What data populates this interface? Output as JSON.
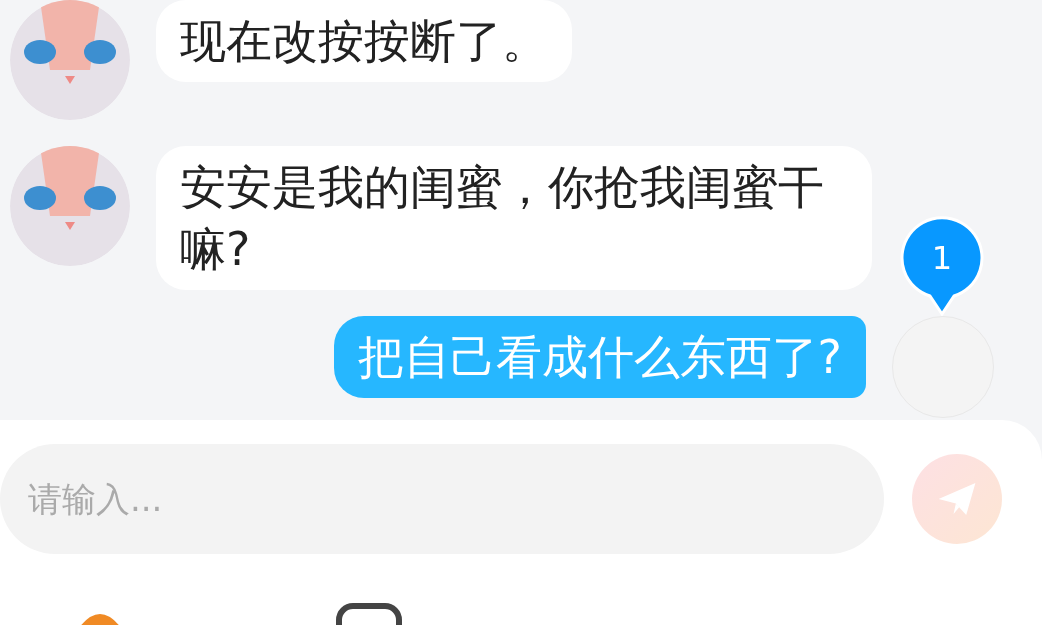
{
  "messages": [
    {
      "kind": "received",
      "text": "现在改按按断了。"
    },
    {
      "kind": "received",
      "text": "安安是我的闺蜜，你抢我闺蜜干嘛?"
    },
    {
      "kind": "sent",
      "text": "把自己看成什么东西了?",
      "badge": "1"
    }
  ],
  "composer": {
    "placeholder": "请输入..."
  }
}
